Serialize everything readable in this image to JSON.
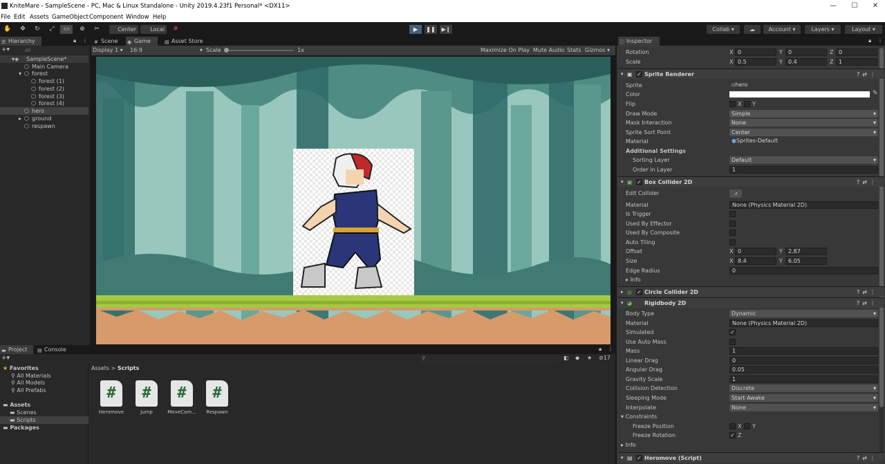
{
  "window": {
    "title": "KniteMare - SampleScene - PC, Mac & Linux Standalone - Unity 2019.4.23f1 Personal* <DX11>"
  },
  "menu": [
    "File",
    "Edit",
    "Assets",
    "GameObject",
    "Component",
    "Window",
    "Help"
  ],
  "toolbar": {
    "center": "Center",
    "local": "Local",
    "collab": "Collab",
    "account": "Account",
    "layers": "Layers",
    "layout": "Layout"
  },
  "hierarchy": {
    "tab": "Hierarchy",
    "search_placeholder": "All",
    "items": [
      {
        "label": "SampleScene*"
      },
      {
        "label": "Main Camera"
      },
      {
        "label": "forest"
      },
      {
        "label": "forest (1)"
      },
      {
        "label": "forest (2)"
      },
      {
        "label": "forest (3)"
      },
      {
        "label": "forest (4)"
      },
      {
        "label": "hero"
      },
      {
        "label": "ground"
      },
      {
        "label": "respawn"
      }
    ]
  },
  "center_tabs": {
    "scene": "Scene",
    "game": "Game",
    "asset_store": "Asset Store"
  },
  "game_toolbar": {
    "display": "Display 1",
    "aspect": "16:9",
    "scale_label": "Scale",
    "scale_value": "1x",
    "maximize": "Maximize On Play",
    "mute": "Mute Audio",
    "stats": "Stats",
    "gizmos": "Gizmos"
  },
  "project": {
    "tabs": {
      "project": "Project",
      "console": "Console"
    },
    "favorites": {
      "label": "Favorites",
      "items": [
        "All Materials",
        "All Models",
        "All Prefabs"
      ]
    },
    "assets": {
      "label": "Assets",
      "items": [
        "Scenes",
        "Scripts"
      ]
    },
    "packages": "Packages",
    "breadcrumb": {
      "root": "Assets",
      "sep": ">",
      "current": "Scripts"
    },
    "hidden_count": "17",
    "scripts": [
      "Heromove",
      "Jump",
      "MoveCam...",
      "Respawn"
    ],
    "script_glyph": "#"
  },
  "inspector": {
    "tab": "Inspector",
    "transform": {
      "rotation_label": "Rotation",
      "rotation": {
        "x": "0",
        "y": "0",
        "z": "0"
      },
      "scale_label": "Scale",
      "scale": {
        "x": "0.5",
        "y": "0.4",
        "z": "1"
      }
    },
    "sprite_renderer": {
      "title": "Sprite Renderer",
      "sprite_label": "Sprite",
      "sprite": "hero",
      "color_label": "Color",
      "flip_label": "Flip",
      "flip_x": "X",
      "flip_y": "Y",
      "draw_mode_label": "Draw Mode",
      "draw_mode": "Simple",
      "mask_label": "Mask Interaction",
      "mask": "None",
      "sort_point_label": "Sprite Sort Point",
      "sort_point": "Center",
      "material_label": "Material",
      "material": "Sprites-Default",
      "additional_label": "Additional Settings",
      "sorting_layer_label": "Sorting Layer",
      "sorting_layer": "Default",
      "order_label": "Order in Layer",
      "order": "1"
    },
    "box_collider": {
      "title": "Box Collider 2D",
      "edit_label": "Edit Collider",
      "material_label": "Material",
      "material": "None (Physics Material 2D)",
      "trigger_label": "Is Trigger",
      "effector_label": "Used By Effector",
      "composite_label": "Used By Composite",
      "tiling_label": "Auto Tiling",
      "offset_label": "Offset",
      "offset": {
        "x": "0",
        "y": "2.87"
      },
      "size_label": "Size",
      "size": {
        "x": "8.4",
        "y": "6.05"
      },
      "edge_label": "Edge Radius",
      "edge": "0",
      "info_label": "Info"
    },
    "circle_collider": {
      "title": "Circle Collider 2D"
    },
    "rigidbody": {
      "title": "Rigidbody 2D",
      "body_type_label": "Body Type",
      "body_type": "Dynamic",
      "material_label": "Material",
      "material": "None (Physics Material 2D)",
      "simulated_label": "Simulated",
      "auto_mass_label": "Use Auto Mass",
      "mass_label": "Mass",
      "mass": "1",
      "linear_label": "Linear Drag",
      "linear": "0",
      "angular_label": "Angular Drag",
      "angular": "0.05",
      "gravity_label": "Gravity Scale",
      "gravity": "1",
      "collision_label": "Collision Detection",
      "collision": "Discrete",
      "sleeping_label": "Sleeping Mode",
      "sleeping": "Start Awake",
      "interpolate_label": "Interpolate",
      "interpolate": "None",
      "constraints_label": "Constraints",
      "freeze_pos_label": "Freeze Position",
      "freeze_rot_label": "Freeze Rotation",
      "x": "X",
      "y": "Y",
      "z": "Z",
      "info_label": "Info"
    },
    "heromove": {
      "title": "Heromove (Script)"
    },
    "axis": {
      "x": "X",
      "y": "Y",
      "z": "Z"
    }
  }
}
